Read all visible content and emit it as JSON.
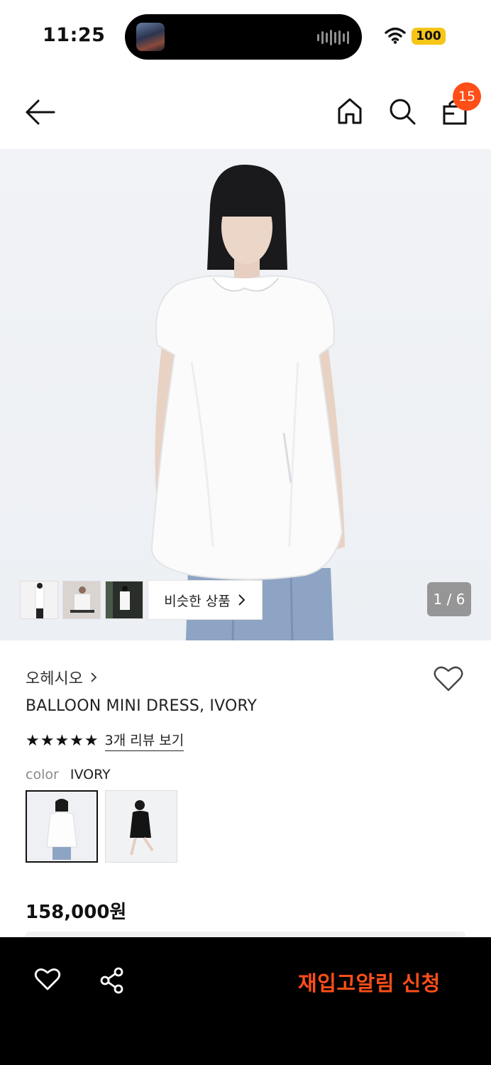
{
  "status_bar": {
    "time": "11:25",
    "battery": "100"
  },
  "header": {
    "cart_count": "15"
  },
  "gallery": {
    "similar_label": "비슷한 상품",
    "pager": "1 / 6"
  },
  "product": {
    "brand": "오헤시오",
    "name": "BALLOON MINI DRESS, IVORY",
    "rating_stars": "★★★★★",
    "review_link": "3개 리뷰 보기",
    "color_label": "color",
    "color_value": "IVORY",
    "price": "158,000원"
  },
  "bottom_bar": {
    "restock_label": "재입고알림 신청"
  },
  "colors": {
    "accent": "#ff4e17",
    "battery": "#f5c518",
    "bar": "#000000"
  },
  "icons": [
    "back-arrow-icon",
    "home-icon",
    "search-icon",
    "shopping-bag-icon",
    "heart-icon",
    "share-icon",
    "chevron-right-icon",
    "wifi-icon"
  ]
}
